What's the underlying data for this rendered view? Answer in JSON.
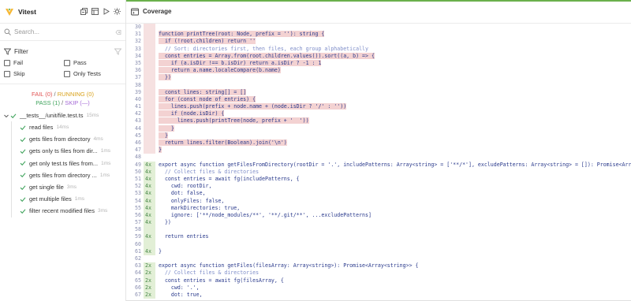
{
  "app": {
    "title": "Vitest"
  },
  "search": {
    "placeholder": "Search..."
  },
  "filter": {
    "label": "Filter",
    "options": [
      {
        "label": "Fail",
        "checked": false
      },
      {
        "label": "Pass",
        "checked": false
      },
      {
        "label": "Skip",
        "checked": false
      },
      {
        "label": "Only Tests",
        "checked": false
      }
    ]
  },
  "summary": {
    "fail": "FAIL (0)",
    "running": "RUNNING (0)",
    "pass": "PASS (1)",
    "skip": "SKIP (—)",
    "separator": "/"
  },
  "tree": {
    "file": {
      "name": "__tests__/unit/file.test.ts",
      "duration": "15ms"
    },
    "tests": [
      {
        "name": "read files",
        "duration": "14ms"
      },
      {
        "name": "gets files from directory",
        "duration": "4ms"
      },
      {
        "name": "gets only ts files from dir...",
        "duration": "1ms"
      },
      {
        "name": "get only test.ts files from...",
        "duration": "1ms"
      },
      {
        "name": "gets files from directory ...",
        "duration": "1ms"
      },
      {
        "name": "get single file",
        "duration": "3ms"
      },
      {
        "name": "get multiple files",
        "duration": "1ms"
      },
      {
        "name": "filter recent modified files",
        "duration": "3ms"
      }
    ]
  },
  "main": {
    "title": "Coverage",
    "accent_color": "#6ab04c",
    "uncovered_color": "#f3d2d2",
    "covered_count_color": "#e2efd6"
  },
  "code_lines": [
    {
      "n": "30",
      "c": "",
      "t": "",
      "hl": true,
      "cov": "uncov"
    },
    {
      "n": "31",
      "c": "",
      "t": "function printTree(root: Node, prefix = ''): string {",
      "hl": true,
      "cov": "uncov"
    },
    {
      "n": "32",
      "c": "",
      "t": "  if (!root.children) return ''",
      "hl": true,
      "cov": "uncov"
    },
    {
      "n": "33",
      "c": "",
      "t": "  // Sort: directories first, then files, each group alphabetically",
      "hl": false,
      "cov": "uncov",
      "comment": true
    },
    {
      "n": "34",
      "c": "",
      "t": "  const entries = Array.from(root.children.values()).sort((a, b) => {",
      "hl": true,
      "cov": "uncov"
    },
    {
      "n": "35",
      "c": "",
      "t": "    if (a.isDir !== b.isDir) return a.isDir ? -1 : 1",
      "hl": true,
      "cov": "uncov"
    },
    {
      "n": "36",
      "c": "",
      "t": "    return a.name.localeCompare(b.name)",
      "hl": true,
      "cov": "uncov"
    },
    {
      "n": "37",
      "c": "",
      "t": "  })",
      "hl": true,
      "cov": "uncov"
    },
    {
      "n": "38",
      "c": "",
      "t": "",
      "hl": false,
      "cov": "uncov"
    },
    {
      "n": "39",
      "c": "",
      "t": "  const lines: string[] = []",
      "hl": true,
      "cov": "uncov"
    },
    {
      "n": "40",
      "c": "",
      "t": "  for (const node of entries) {",
      "hl": true,
      "cov": "uncov"
    },
    {
      "n": "41",
      "c": "",
      "t": "    lines.push(prefix + node.name + (node.isDir ? '/' : ''))",
      "hl": true,
      "cov": "uncov"
    },
    {
      "n": "42",
      "c": "",
      "t": "    if (node.isDir) {",
      "hl": true,
      "cov": "uncov"
    },
    {
      "n": "43",
      "c": "",
      "t": "      lines.push(printTree(node, prefix + '  '))",
      "hl": true,
      "cov": "uncov"
    },
    {
      "n": "44",
      "c": "",
      "t": "    }",
      "hl": true,
      "cov": "uncov"
    },
    {
      "n": "45",
      "c": "",
      "t": "  }",
      "hl": true,
      "cov": "uncov"
    },
    {
      "n": "46",
      "c": "",
      "t": "  return lines.filter(Boolean).join('\\n')",
      "hl": true,
      "cov": "uncov"
    },
    {
      "n": "47",
      "c": "",
      "t": "}",
      "hl": true,
      "cov": "uncov"
    },
    {
      "n": "48",
      "c": "",
      "t": "",
      "hl": false,
      "cov": ""
    },
    {
      "n": "49",
      "c": "4x",
      "t": "export async function getFilesFromDirectory(rootDir = '.', includePatterns: Array<string> = ['**/*'], excludePatterns: Array<string> = []): Promise<Array<string>> {",
      "hl": false,
      "cov": "covered"
    },
    {
      "n": "50",
      "c": "4x",
      "t": "  // Collect files & directories",
      "hl": false,
      "cov": "covered",
      "comment": true
    },
    {
      "n": "51",
      "c": "4x",
      "t": "  const entries = await fg(includePatterns, {",
      "hl": false,
      "cov": "covered"
    },
    {
      "n": "52",
      "c": "4x",
      "t": "    cwd: rootDir,",
      "hl": false,
      "cov": "covered"
    },
    {
      "n": "53",
      "c": "4x",
      "t": "    dot: false,",
      "hl": false,
      "cov": "covered"
    },
    {
      "n": "54",
      "c": "4x",
      "t": "    onlyFiles: false,",
      "hl": false,
      "cov": "covered"
    },
    {
      "n": "55",
      "c": "4x",
      "t": "    markDirectories: true,",
      "hl": false,
      "cov": "covered"
    },
    {
      "n": "56",
      "c": "4x",
      "t": "    ignore: ['**/node_modules/**', '**/.git/**', ...excludePatterns]",
      "hl": false,
      "cov": "covered"
    },
    {
      "n": "57",
      "c": "4x",
      "t": "  })",
      "hl": false,
      "cov": "covered"
    },
    {
      "n": "58",
      "c": "",
      "t": "",
      "hl": false,
      "cov": "covered"
    },
    {
      "n": "59",
      "c": "4x",
      "t": "  return entries",
      "hl": false,
      "cov": "covered"
    },
    {
      "n": "60",
      "c": "",
      "t": "",
      "hl": false,
      "cov": "covered"
    },
    {
      "n": "61",
      "c": "4x",
      "t": "}",
      "hl": false,
      "cov": "covered"
    },
    {
      "n": "62",
      "c": "",
      "t": "",
      "hl": false,
      "cov": ""
    },
    {
      "n": "63",
      "c": "2x",
      "t": "export async function getFiles(filesArray: Array<string>): Promise<Array<string>> {",
      "hl": false,
      "cov": "covered"
    },
    {
      "n": "64",
      "c": "2x",
      "t": "  // Collect files & directories",
      "hl": false,
      "cov": "covered",
      "comment": true
    },
    {
      "n": "65",
      "c": "2x",
      "t": "  const entries = await fg(filesArray, {",
      "hl": false,
      "cov": "covered"
    },
    {
      "n": "66",
      "c": "2x",
      "t": "    cwd: '.',",
      "hl": false,
      "cov": "covered"
    },
    {
      "n": "67",
      "c": "2x",
      "t": "    dot: true,",
      "hl": false,
      "cov": "covered"
    }
  ]
}
